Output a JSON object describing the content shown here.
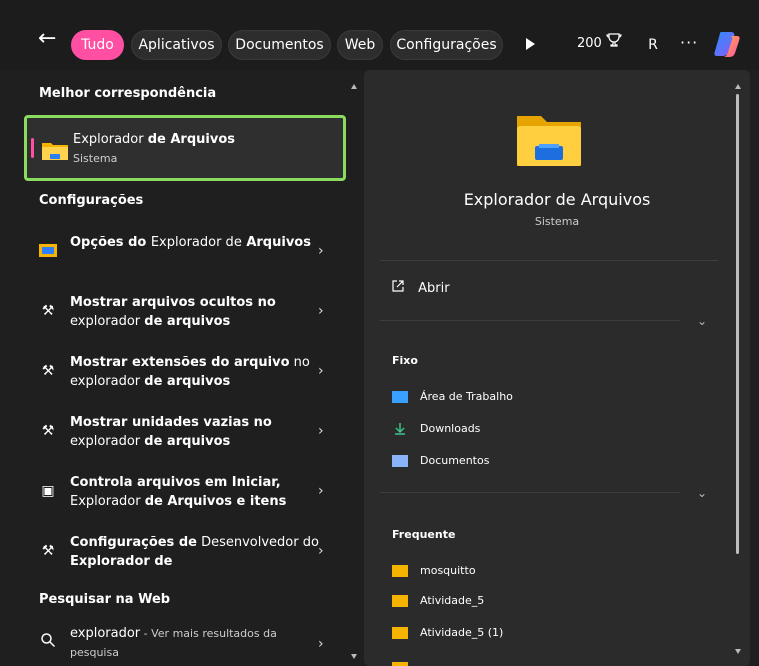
{
  "topbar": {
    "back_icon": "arrow-left-icon",
    "tabs": [
      {
        "label": "Tudo",
        "active": true
      },
      {
        "label": "Aplicativos"
      },
      {
        "label": "Documentos"
      },
      {
        "label": "Web"
      },
      {
        "label": "Configurações"
      }
    ],
    "points": "200",
    "avatar": "R",
    "more": "···",
    "accent": "#ff4fa3"
  },
  "left": {
    "best_match_header": "Melhor correspondência",
    "best_match": {
      "title_normal": "Explorador ",
      "title_bold": "de Arquivos",
      "subtitle": "Sistema"
    },
    "settings_header": "Configurações",
    "settings": [
      {
        "icon": "settings-window-icon",
        "a": "Opções do ",
        "b": "Explorador de",
        "c": " Arquivos"
      },
      {
        "icon": "hidden-files-icon",
        "a": "Mostrar arquivos ocultos no",
        "b": " explorador ",
        "c": "de arquivos"
      },
      {
        "icon": "file-extensions-icon",
        "a": "Mostrar extensões do arquivo",
        "b": " no explorador ",
        "c": "de arquivos"
      },
      {
        "icon": "empty-drives-icon",
        "a": "Mostrar unidades vazias no",
        "b": " explorador ",
        "c": "de arquivos"
      },
      {
        "icon": "control-icon",
        "a": "Controla arquivos em Iniciar,",
        "b": " Explorador ",
        "c": "de Arquivos e itens"
      },
      {
        "icon": "developer-icon",
        "a": "Configurações de",
        "b": " Desenvolvedor do ",
        "c": "Explorador de"
      }
    ],
    "web_header": "Pesquisar na Web",
    "web": {
      "query": "explorador",
      "suffix": " - Ver mais resultados da pesquisa"
    }
  },
  "right": {
    "title": "Explorador de Arquivos",
    "subtitle": "Sistema",
    "open_label": "Abrir",
    "pinned_header": "Fixo",
    "pinned": [
      {
        "label": "Área de Trabalho",
        "icon": "desktop-icon"
      },
      {
        "label": "Downloads",
        "icon": "download-icon"
      },
      {
        "label": "Documentos",
        "icon": "document-icon"
      }
    ],
    "frequent_header": "Frequente",
    "frequent": [
      {
        "label": "mosquitto"
      },
      {
        "label": "Atividade_5"
      },
      {
        "label": "Atividade_5 (1)"
      }
    ]
  }
}
